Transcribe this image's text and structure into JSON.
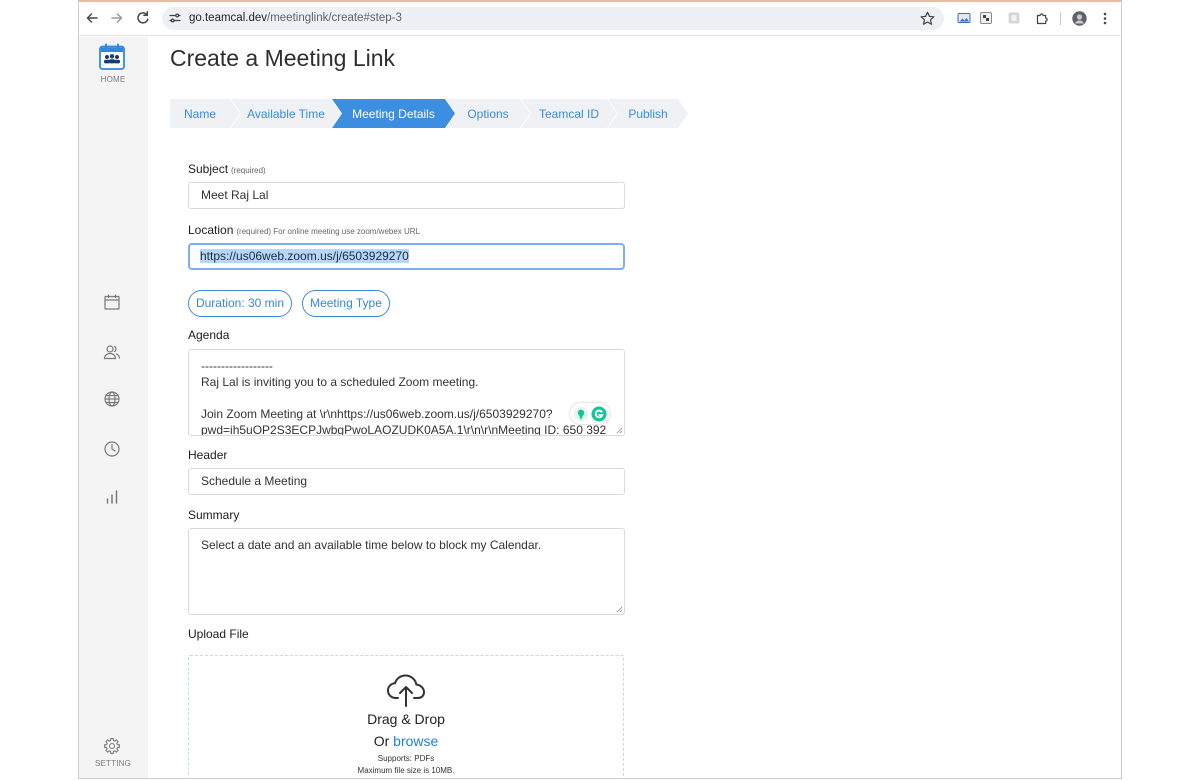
{
  "browser": {
    "url_domain": "go.teamcal.dev",
    "url_path": "/meetinglink/create#step-3",
    "icons": [
      "back-arrow-icon",
      "forward-arrow-icon",
      "reload-icon",
      "site-info-icon",
      "bookmark-star-icon",
      "image-extension-icon",
      "extension-icon",
      "extension-icon",
      "puzzle-icon",
      "profile-avatar",
      "more-menu-icon"
    ]
  },
  "sidebar": {
    "home_icon": "calendar-team-icon",
    "home_label": "HOME",
    "items": [
      {
        "icon": "calendar-icon"
      },
      {
        "icon": "users-icon"
      },
      {
        "icon": "globe-icon"
      },
      {
        "icon": "clock-icon"
      },
      {
        "icon": "bar-chart-icon"
      }
    ],
    "setting_icon": "gear-icon",
    "setting_label": "SETTING"
  },
  "page": {
    "title": "Create a Meeting Link"
  },
  "steps": [
    {
      "label": "Name",
      "active": false
    },
    {
      "label": "Available Time",
      "active": false
    },
    {
      "label": "Meeting Details",
      "active": true
    },
    {
      "label": "Options",
      "active": false
    },
    {
      "label": "Teamcal ID",
      "active": false
    },
    {
      "label": "Publish",
      "active": false
    }
  ],
  "form": {
    "subject": {
      "label": "Subject",
      "hint": "(required)",
      "value": "Meet Raj Lal"
    },
    "location": {
      "label": "Location",
      "hint": "(required) For online meeting use zoom/webex URL",
      "value": "https://us06web.zoom.us/j/6503929270"
    },
    "duration_button": "Duration: 30 min",
    "meeting_type_button": "Meeting Type",
    "agenda": {
      "label": "Agenda",
      "lines": [
        "------------------",
        "Raj Lal is inviting you to a scheduled Zoom meeting.",
        "",
        "Join Zoom Meeting at \\r\\nhttps://us06web.zoom.us/j/6503929270?",
        "pwd=ih5uOP2S3ECPJwbgPwoLAOZUDK0A5A.1\\r\\n\\r\\nMeeting ID:  650 392"
      ]
    },
    "header": {
      "label": "Header",
      "value": "Schedule a Meeting"
    },
    "summary": {
      "label": "Summary",
      "value": "Select a date and an available time below to block my Calendar."
    },
    "upload": {
      "label": "Upload File",
      "icon": "cloud-upload-icon",
      "drag_text": "Drag & Drop",
      "or_text": "Or ",
      "browse_text": "browse",
      "supports": "Supports: PDFs",
      "max_size": "Maximum file size is 10MB."
    }
  },
  "colors": {
    "accent": "#3b8ee0",
    "step_bg": "#eff1f4",
    "sidebar_bg": "#f4f4f4",
    "link": "#1e7fd8",
    "selection": "#b7d6fb",
    "grammarly": "#15c39a"
  }
}
